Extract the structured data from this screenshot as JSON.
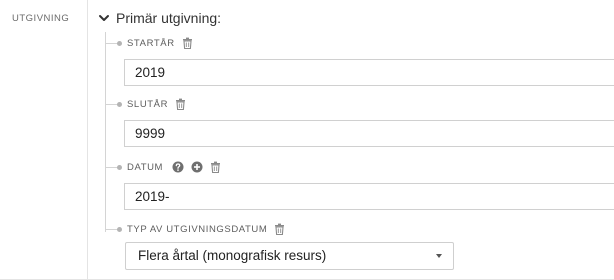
{
  "section": {
    "side_label": "UTGIVNING",
    "title": "Primär utgivning:"
  },
  "fields": {
    "start_year": {
      "label": "STARTÅR",
      "value": "2019"
    },
    "end_year": {
      "label": "SLUTÅR",
      "value": "9999"
    },
    "date": {
      "label": "DATUM",
      "value": "2019-"
    },
    "date_type": {
      "label": "TYP AV UTGIVNINGSDATUM",
      "selected": "Flera årtal (monografisk resurs)"
    }
  },
  "icons": {
    "collapse": "chevron-down-icon",
    "delete": "trash-icon",
    "help": "question-circle-icon",
    "add": "plus-circle-icon",
    "dropdown": "caret-down-icon"
  }
}
